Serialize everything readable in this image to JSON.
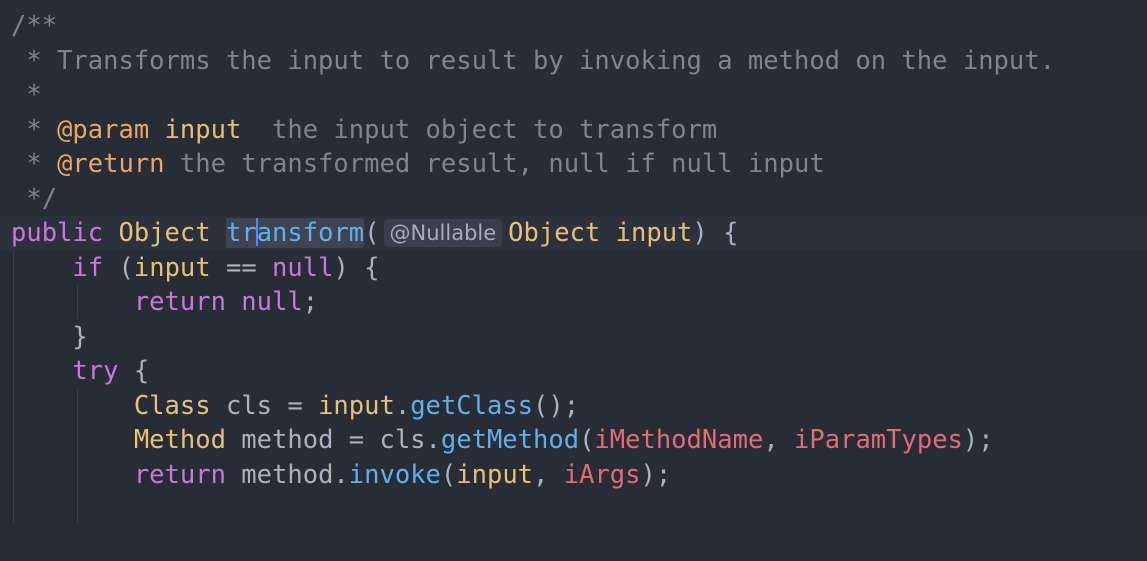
{
  "doc": {
    "open": "/**",
    "line1": " * Transforms the input to result by invoking a method on the input.",
    "line2": " *",
    "param_prefix": " * ",
    "param_tag": "@param",
    "param_name": " input",
    "param_desc": "  the input object to transform",
    "return_prefix": " * ",
    "return_tag": "@return",
    "return_desc": " the transformed result, null if null input",
    "close": " */"
  },
  "signature": {
    "kw_public": "public",
    "type_object": "Object",
    "name_part1": "tr",
    "name_part2": "ansform",
    "paren_open": "(",
    "hint": "@Nullable",
    "param_type": "Object",
    "param_name": "input",
    "tail": ") {"
  },
  "body": {
    "if_kw": "if",
    "if_open": " (",
    "if_var": "input",
    "if_mid": " == ",
    "if_null": "null",
    "if_close": ") {",
    "ret1_kw": "return",
    "ret1_null": " null",
    "ret1_semi": ";",
    "close_brace": "}",
    "try_kw": "try",
    "try_brace": " {",
    "l1_type": "Class",
    "l1_mid": " cls = ",
    "l1_var": "input",
    "l1_dot": ".",
    "l1_fn": "getClass",
    "l1_end": "();",
    "l2_type": "Method",
    "l2_mid": " method = cls.",
    "l2_fn": "getMethod",
    "l2_open": "(",
    "l2_f1": "iMethodName",
    "l2_comma": ", ",
    "l2_f2": "iParamTypes",
    "l2_end": ");",
    "l3_kw": "return",
    "l3_mid": " method.",
    "l3_fn": "invoke",
    "l3_open": "(",
    "l3_var": "input",
    "l3_comma": ", ",
    "l3_f": "iArgs",
    "l3_end": ");"
  },
  "colors": {
    "background": "#282c34",
    "comment": "#7f848e",
    "keyword": "#c678dd",
    "type": "#e5c07b",
    "function": "#61afef",
    "field": "#e06c75",
    "caret": "#528bff"
  }
}
